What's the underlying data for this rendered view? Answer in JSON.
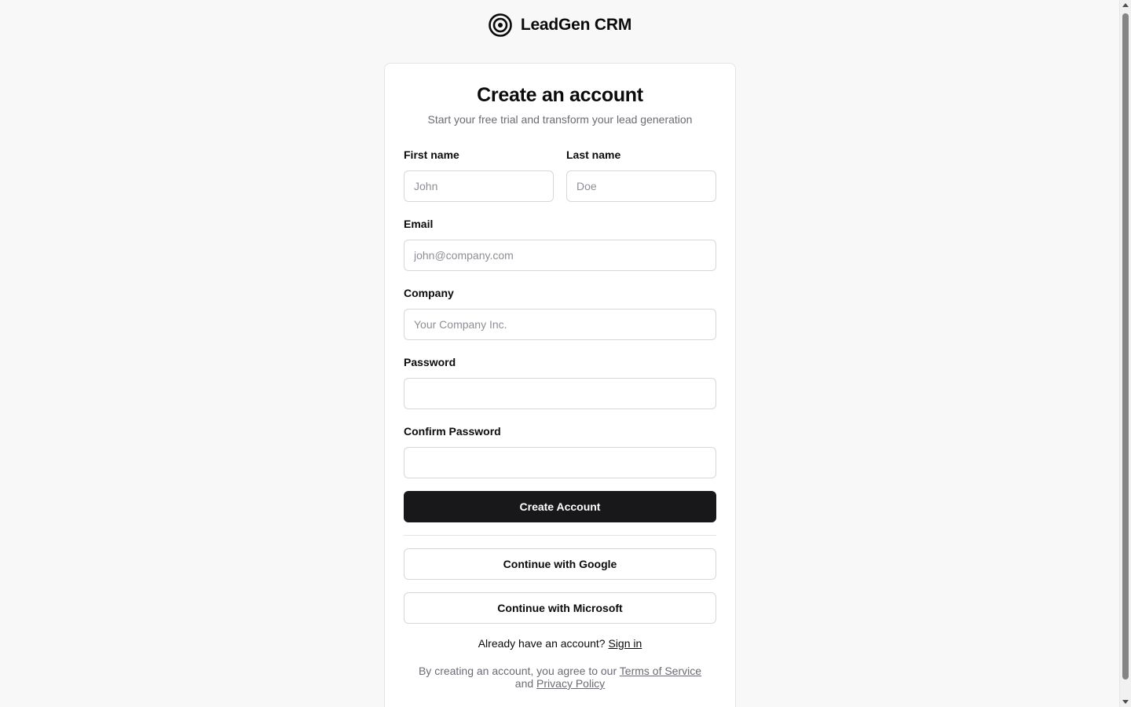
{
  "brand": {
    "name": "LeadGen CRM",
    "icon": "target-icon"
  },
  "form": {
    "title": "Create an account",
    "subtitle": "Start your free trial and transform your lead generation",
    "first_name": {
      "label": "First name",
      "placeholder": "John",
      "value": ""
    },
    "last_name": {
      "label": "Last name",
      "placeholder": "Doe",
      "value": ""
    },
    "email": {
      "label": "Email",
      "placeholder": "john@company.com",
      "value": ""
    },
    "company": {
      "label": "Company",
      "placeholder": "Your Company Inc.",
      "value": ""
    },
    "password": {
      "label": "Password",
      "value": ""
    },
    "confirm_password": {
      "label": "Confirm Password",
      "value": ""
    },
    "submit_label": "Create Account",
    "google_label": "Continue with Google",
    "microsoft_label": "Continue with Microsoft"
  },
  "signin": {
    "prompt": "Already have an account?",
    "link_label": "Sign in"
  },
  "legal": {
    "prefix": "By creating an account, you agree to our",
    "terms_label": "Terms of Service",
    "and": "and",
    "privacy_label": "Privacy Policy"
  },
  "colors": {
    "background": "#f8f8f8",
    "card": "#ffffff",
    "primary": "#18181b",
    "muted_text": "#6b6b73",
    "border": "#d7d7dc"
  }
}
